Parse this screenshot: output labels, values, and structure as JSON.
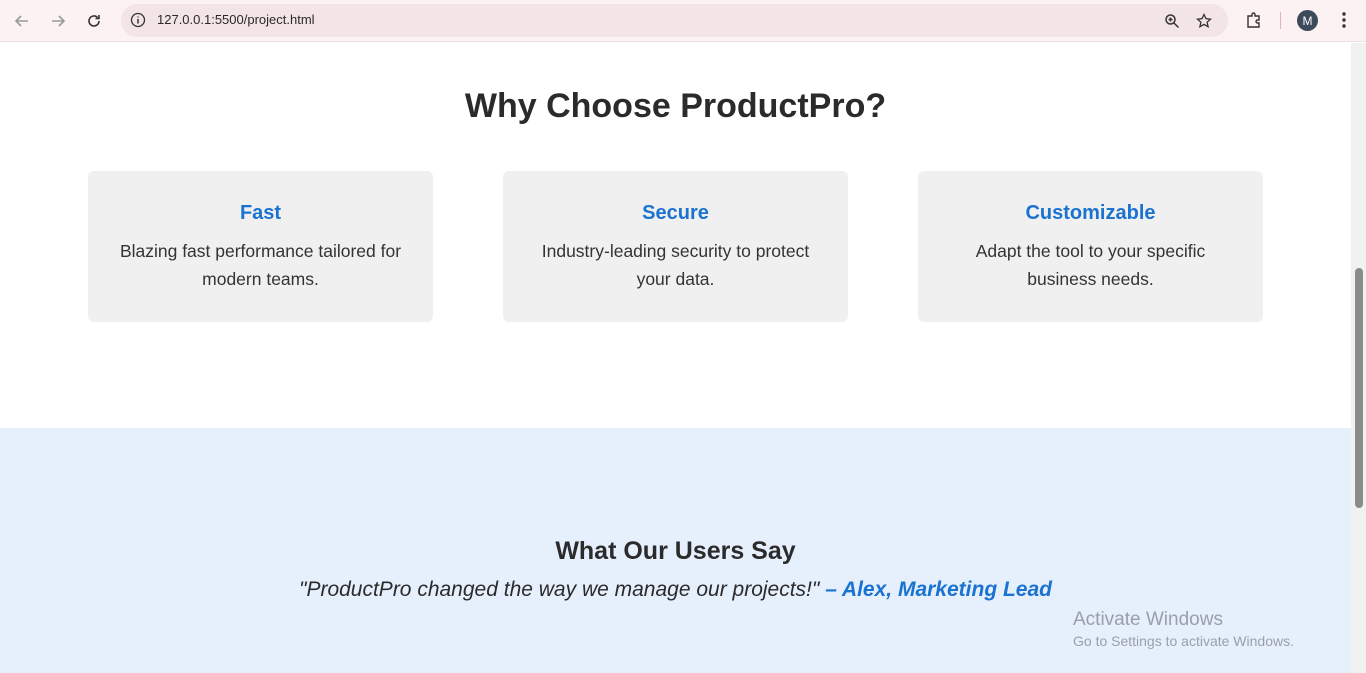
{
  "browser": {
    "url": "127.0.0.1:5500/project.html",
    "avatar_letter": "M",
    "icons": [
      "back-icon",
      "forward-icon",
      "reload-icon",
      "info-icon",
      "zoom-icon",
      "star-icon",
      "extensions-icon",
      "menu-icon"
    ]
  },
  "features": {
    "title": "Why Choose ProductPro?",
    "cards": [
      {
        "title": "Fast",
        "text": "Blazing fast performance tailored for modern teams."
      },
      {
        "title": "Secure",
        "text": "Industry-leading security to protect your data."
      },
      {
        "title": "Customizable",
        "text": "Adapt the tool to your specific business needs."
      }
    ]
  },
  "testimonials": {
    "title": "What Our Users Say",
    "quote": "\"ProductPro changed the way we manage our projects!\"",
    "author": " – Alex, Marketing Lead"
  },
  "watermark": {
    "line1": "Activate Windows",
    "line2": "Go to Settings to activate Windows."
  },
  "colors": {
    "accent": "#1a73d0",
    "card_bg": "#f0f0f0",
    "testimonial_bg": "#e6effc",
    "toolbar_bg": "#fdf2f3"
  }
}
